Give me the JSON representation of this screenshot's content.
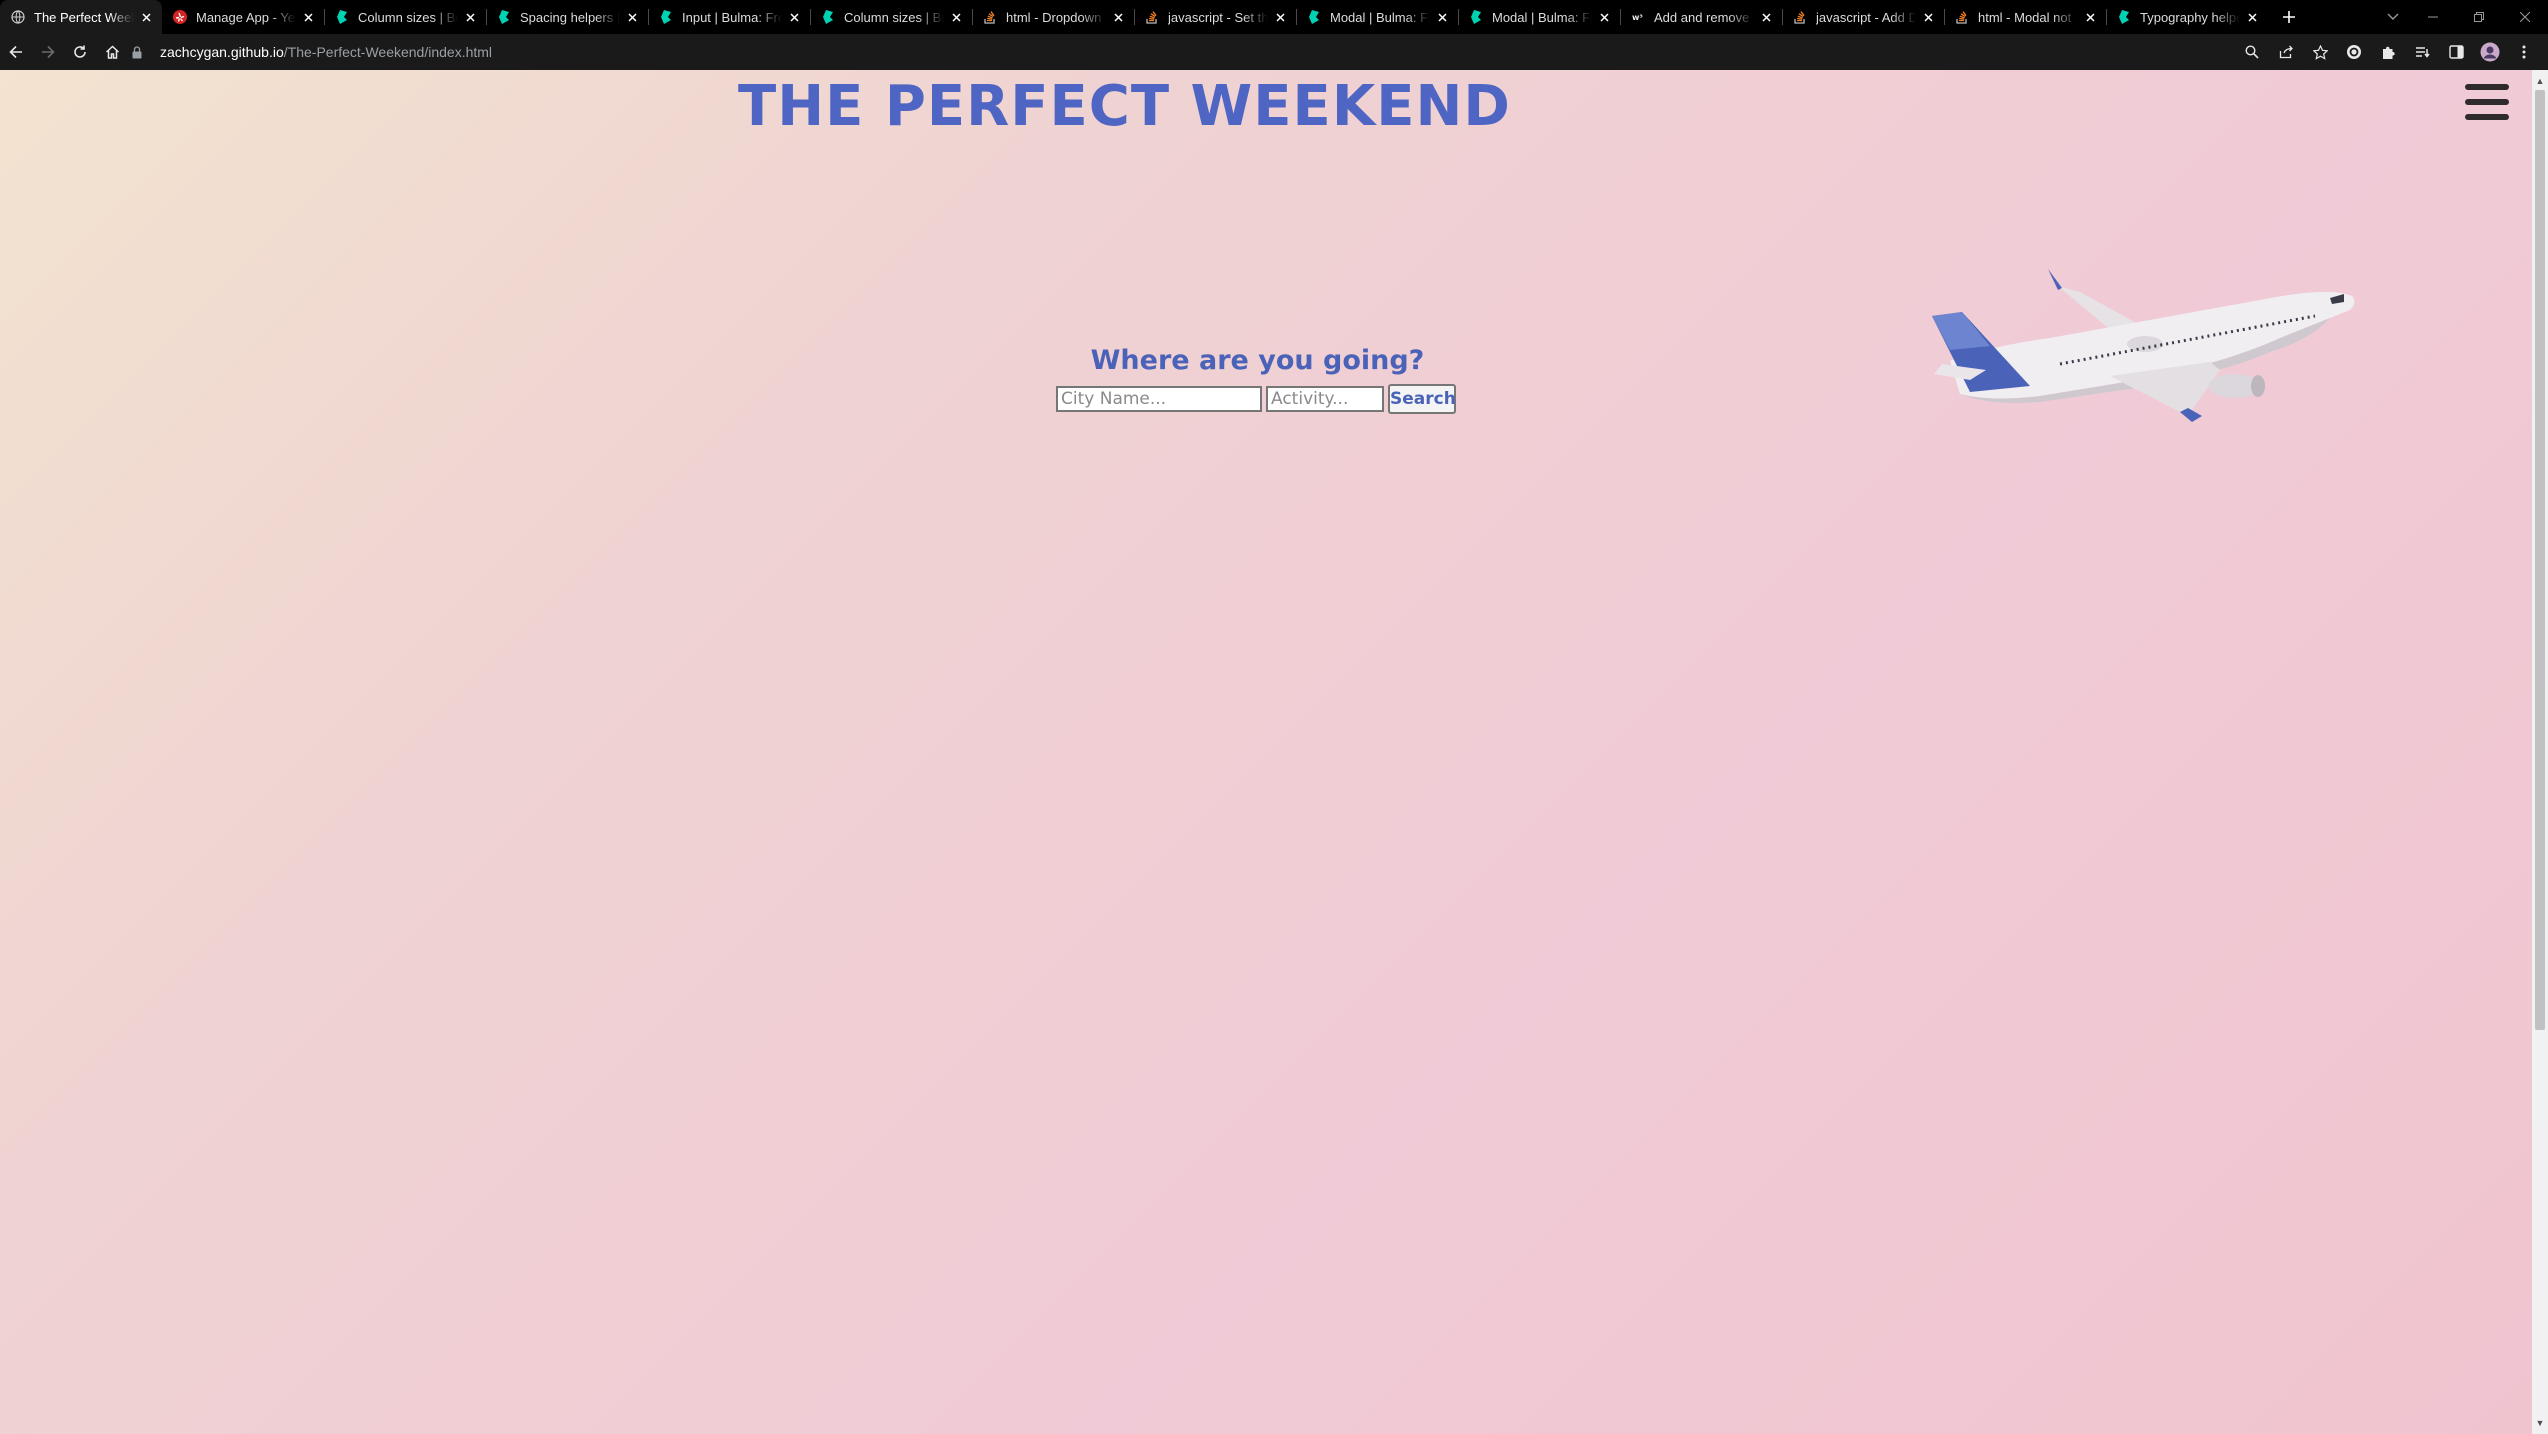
{
  "browser": {
    "tabs": [
      {
        "title": "The Perfect Weeke",
        "icon": "globe-icon",
        "active": true
      },
      {
        "title": "Manage App - Yelp",
        "icon": "yelp-icon",
        "active": false
      },
      {
        "title": "Column sizes | Bul",
        "icon": "bulma-icon",
        "active": false
      },
      {
        "title": "Spacing helpers | E",
        "icon": "bulma-icon",
        "active": false
      },
      {
        "title": "Input | Bulma: Free",
        "icon": "bulma-icon",
        "active": false
      },
      {
        "title": "Column sizes | Bul",
        "icon": "bulma-icon",
        "active": false
      },
      {
        "title": "html - Dropdown",
        "icon": "stackoverflow-icon",
        "active": false
      },
      {
        "title": "javascript - Set the",
        "icon": "stackoverflow-icon",
        "active": false
      },
      {
        "title": "Modal | Bulma: Fre",
        "icon": "bulma-icon",
        "active": false
      },
      {
        "title": "Modal | Bulma: Fre",
        "icon": "bulma-icon",
        "active": false
      },
      {
        "title": "Add and remove c",
        "icon": "w3schools-icon",
        "active": false
      },
      {
        "title": "javascript - Add D",
        "icon": "stackoverflow-icon",
        "active": false
      },
      {
        "title": "html - Modal not",
        "icon": "stackoverflow-icon",
        "active": false
      },
      {
        "title": "Typography helpe",
        "icon": "bulma-icon",
        "active": false
      }
    ],
    "url_host": "zachcygan.github.io",
    "url_path": "/The-Perfect-Weekend/index.html",
    "colors": {
      "bulma": "#00d1b2",
      "yelp": "#d32323",
      "stackoverflow": "#f48024"
    }
  },
  "page": {
    "title": "THE PERFECT WEEKEND",
    "heading": "Where are you going?",
    "city_placeholder": "City Name...",
    "activity_placeholder": "Activity...",
    "search_label": "Search",
    "colors": {
      "title": "#4f65c3",
      "heading": "#4a63b8",
      "gradient_start": "#f3e3d0",
      "gradient_end": "#f0c4cf"
    }
  }
}
